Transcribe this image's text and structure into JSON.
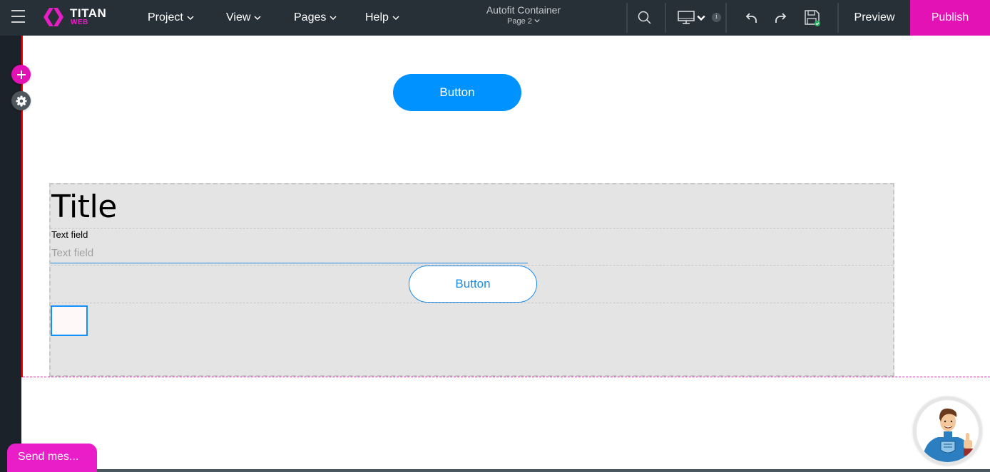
{
  "app": {
    "logo_title": "TITAN",
    "logo_subtitle": "WEB"
  },
  "topbar": {
    "menus": [
      {
        "label": "Project"
      },
      {
        "label": "View"
      },
      {
        "label": "Pages"
      },
      {
        "label": "Help"
      }
    ],
    "project_name": "Autofit Container",
    "page_selector": "Page 2",
    "info_badge": "i",
    "preview_label": "Preview",
    "publish_label": "Publish",
    "icons": [
      "menu-icon",
      "search-icon",
      "desktop-icon",
      "undo-icon",
      "redo-icon",
      "save-icon"
    ]
  },
  "left_rail": {
    "add_icon": "plus-icon",
    "settings_icon": "gear-icon"
  },
  "canvas": {
    "top_button_label": "Button",
    "autofit_container": {
      "title": "Title",
      "text_field_label": "Text field",
      "text_field_placeholder": "Text field",
      "text_field_value": "",
      "button_label": "Button"
    }
  },
  "chat": {
    "send_message_label": "Send mes..."
  },
  "colors": {
    "brand_pink": "#e312b5",
    "primary_blue": "#0093ff",
    "topbar_bg": "#272f37",
    "container_bg": "#e4e4e4"
  }
}
